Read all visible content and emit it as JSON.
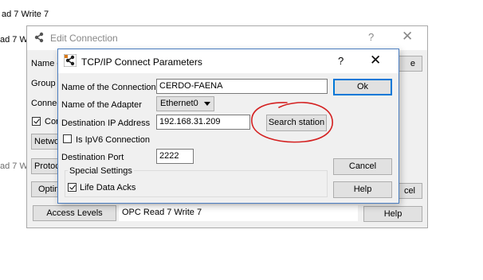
{
  "background": {
    "line1": "ad 7 Write 7",
    "line2": "ad 7 W",
    "line3": "ad 7 Wr"
  },
  "edit_connection": {
    "title": "Edit Connection",
    "help_glyph": "?",
    "close_glyph": "✕",
    "labels": {
      "name": "Name o",
      "group": "Group N",
      "connection": "Connec",
      "checkbox_label": "Con"
    },
    "buttons": {
      "network": "Netwo",
      "protocol": "Protoc",
      "options": "Optin",
      "right_top": "e",
      "cancel_partial": "cel",
      "help": "Help",
      "access_levels": "Access Levels"
    },
    "opc_field": "OPC Read 7 Write 7"
  },
  "tcpip": {
    "title": "TCP/IP Connect Parameters",
    "help_glyph": "?",
    "close_glyph": "✕",
    "labels": {
      "connection_name": "Name of the Connection",
      "adapter": "Name of the Adapter",
      "dest_ip": "Destination IP Address",
      "ipv6": "Is IpV6 Connection",
      "dest_port": "Destination Port",
      "special_settings": "Special Settings",
      "life_data_acks": "Life Data Acks"
    },
    "values": {
      "connection_name": "CERDO-FAENA",
      "adapter": "Ethernet0",
      "dest_ip": "192.168.31.209",
      "dest_port": "2222"
    },
    "checkboxes": {
      "ipv6": false,
      "life_data_acks": true
    },
    "buttons": {
      "ok": "Ok",
      "search_station": "Search station",
      "cancel": "Cancel",
      "help": "Help"
    }
  },
  "annotation": {
    "color": "#d42020"
  }
}
